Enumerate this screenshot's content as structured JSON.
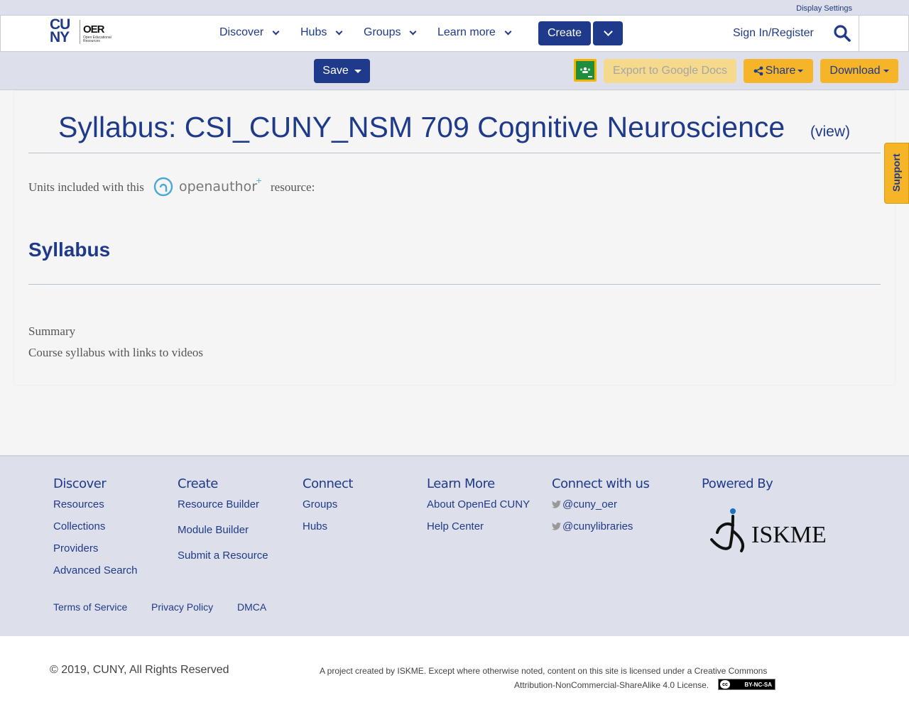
{
  "top_strip": {
    "display_settings": "Display Settings"
  },
  "header": {
    "logo": {
      "main": "CUNY",
      "oer": "OER",
      "oer_sub": "Open Educational Resources"
    },
    "nav": [
      {
        "label": "Discover"
      },
      {
        "label": "Hubs"
      },
      {
        "label": "Groups"
      },
      {
        "label": "Learn more"
      }
    ],
    "create_label": "Create",
    "signin_label": "Sign In/Register"
  },
  "toolbar": {
    "save_label": "Save",
    "export_label": "Export to Google Docs",
    "share_label": "Share",
    "download_label": "Download"
  },
  "main": {
    "title": "Syllabus: CSI_CUNY_NSM 709 Cognitive Neuroscience",
    "view_link": "(view)",
    "units_prefix": "Units included with this",
    "openauthor_logo": "openauthor",
    "units_suffix": "resource:",
    "section_heading": "Syllabus",
    "summary_label": "Summary",
    "summary_text": "Course syllabus with links to videos"
  },
  "support_tab": "Support",
  "footer": {
    "discover": {
      "title": "Discover",
      "links": [
        "Resources",
        "Collections",
        "Providers",
        "Advanced Search"
      ]
    },
    "create": {
      "title": "Create",
      "links": [
        "Resource Builder",
        "Module Builder",
        "Submit a Resource"
      ]
    },
    "connect": {
      "title": "Connect",
      "links": [
        "Groups",
        "Hubs"
      ]
    },
    "learn_more": {
      "title": "Learn More",
      "links": [
        "About OpenEd CUNY",
        "Help Center"
      ]
    },
    "connect_with_us": {
      "title": "Connect with us",
      "links": [
        "@cuny_oer",
        "@cunylibraries"
      ]
    },
    "powered_by": {
      "title": "Powered By",
      "logo": "ISKME"
    },
    "legal_links": [
      "Terms of Service",
      "Privacy Policy",
      "DMCA"
    ]
  },
  "bottom": {
    "copyright": "© 2019, CUNY, All Rights Reserved",
    "license_line1": "A project created by ISKME. Except where otherwise noted, content on this site is licensed under a Creative Commons",
    "license_line2": "Attribution-NonCommercial-ShareAlike 4.0 License.",
    "cc_badge": "BY-NC-SA"
  },
  "colors": {
    "brand_blue": "#1f3a8a",
    "accent_yellow": "#f6b428",
    "nav_bg": "#dde0ea"
  }
}
